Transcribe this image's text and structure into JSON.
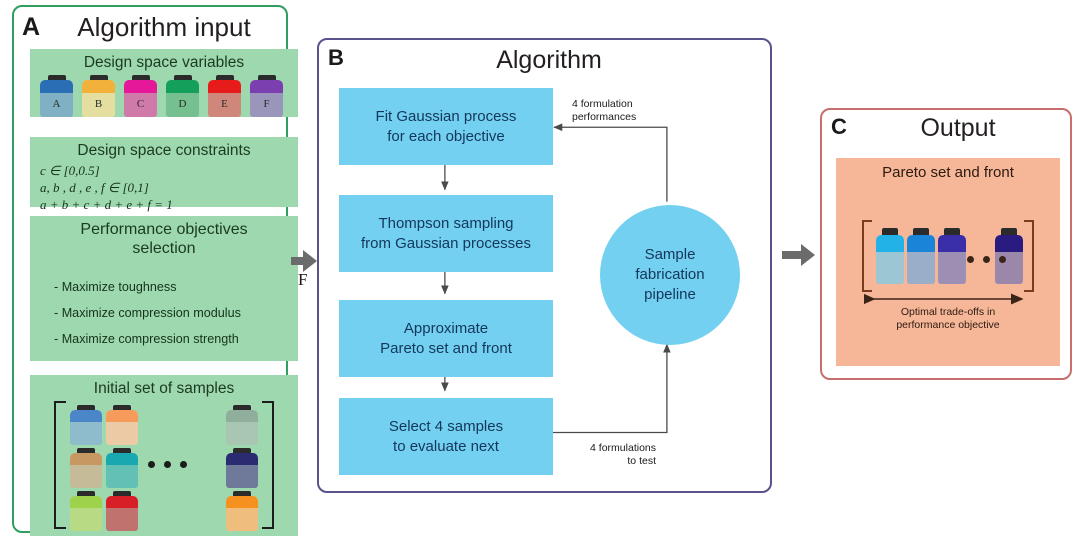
{
  "panels": {
    "a": {
      "letter": "A",
      "title": "Algorithm input",
      "border_color": "#2f9e5e",
      "sections": {
        "variables": {
          "title": "Design space variables",
          "bottles": [
            {
              "label": "A",
              "cap_color": "#2a6fb5",
              "body_color": "#7fb0c4"
            },
            {
              "label": "B",
              "cap_color": "#f2b13a",
              "body_color": "#e4dfa0"
            },
            {
              "label": "C",
              "cap_color": "#e5189a",
              "body_color": "#cf7aa8"
            },
            {
              "label": "D",
              "cap_color": "#14a05a",
              "body_color": "#75c08e"
            },
            {
              "label": "E",
              "cap_color": "#e81b1b",
              "body_color": "#d0877b"
            },
            {
              "label": "F",
              "cap_color": "#7b3fb0",
              "body_color": "#9a95ba"
            }
          ]
        },
        "constraints": {
          "title": "Design space constraints",
          "lines": [
            "c ∈ [0,0.5]",
            "a, b , d , e , f ∈ [0,1]",
            "a + b + c + d + e + f = 1"
          ]
        },
        "objectives": {
          "title_line1": "Performance objectives",
          "title_line2": "selection",
          "items": [
            "- Maximize toughness",
            "- Maximize compression modulus",
            "- Maximize compression strength"
          ]
        },
        "initial_samples": {
          "title": "Initial set of samples",
          "dots": 3,
          "grid": [
            [
              {
                "cap_color": "#4a86c8",
                "body_color": "#8ebccc"
              },
              {
                "cap_color": "#f79b5c",
                "body_color": "#eccaa5"
              },
              {
                "cap_color": "#8fae9c",
                "body_color": "#a9c6b2"
              }
            ],
            [
              {
                "cap_color": "#c79862",
                "body_color": "#c5bb99"
              },
              {
                "cap_color": "#1aa8b0",
                "body_color": "#63c0b5"
              },
              {
                "cap_color": "#2b2b72",
                "body_color": "#6f7a9a"
              }
            ],
            [
              {
                "cap_color": "#9ed24a",
                "body_color": "#b9da84"
              },
              {
                "cap_color": "#d81f28",
                "body_color": "#c0726e"
              },
              {
                "cap_color": "#f5911e",
                "body_color": "#f0be7c"
              }
            ]
          ]
        }
      }
    },
    "b": {
      "letter": "B",
      "title": "Algorithm",
      "border_color": "#58538c",
      "box_color": "#73d0f0",
      "boxes": [
        {
          "line1": "Fit Gaussian process",
          "line2": "for each objective"
        },
        {
          "line1": "Thompson sampling",
          "line2": "from Gaussian processes"
        },
        {
          "line1": "Approximate",
          "line2": "Pareto set and front"
        },
        {
          "line1": "Select 4 samples",
          "line2": "to evaluate next"
        }
      ],
      "circle": {
        "line1": "Sample",
        "line2": "fabrication",
        "line3": "pipeline"
      },
      "flow_labels": {
        "top": {
          "line1": "4 formulation",
          "line2": "performances"
        },
        "bottom": {
          "line1": "4 formulations",
          "line2": "to test"
        }
      }
    },
    "c": {
      "letter": "C",
      "title": "Output",
      "border_color": "#c96d6d",
      "background": "#f6b799",
      "pareto_title": "Pareto set and front",
      "caption_line1": "Optimal trade-offs in",
      "caption_line2": "performance objective",
      "dots": 3,
      "bottles": [
        {
          "cap_color": "#22b2e8",
          "body_color": "#9dc6d4"
        },
        {
          "cap_color": "#1a84d8",
          "body_color": "#9aaec9"
        },
        {
          "cap_color": "#3a2fa8",
          "body_color": "#9d8fb4"
        },
        {
          "cap_color": "#2a1b80",
          "body_color": "#9b87aa"
        }
      ]
    }
  },
  "connectors": {
    "a_to_b_label": "F",
    "arrow_color": "#6b6b6b"
  }
}
